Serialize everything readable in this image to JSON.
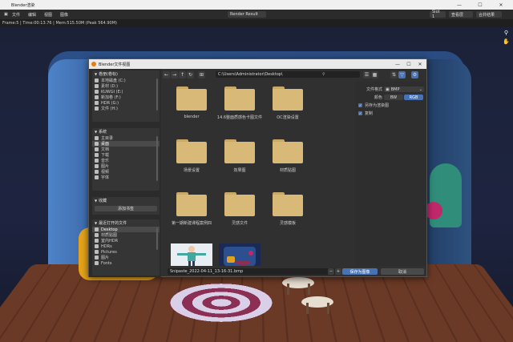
{
  "window": {
    "title": "Blender渲染",
    "controls": [
      "—",
      "☐",
      "✕"
    ]
  },
  "menubar": {
    "items": [
      "文件",
      "编辑",
      "视图",
      "图像"
    ],
    "image_name": "Render Result",
    "slot": "Slot 1",
    "layer": "查看层",
    "pass": "合并结果"
  },
  "infobar": {
    "text": "Frame:5 | Time:00:13.76 | Mem:515.50M (Peak 564.90M)"
  },
  "dialog": {
    "title": "Blender文件视图",
    "path": "C:\\Users\\Administrator\\Desktop\\",
    "search_placeholder": "",
    "sidebar": {
      "volumes": {
        "header": "卷册(卷标)",
        "items": [
          "本地磁盘 (C:)",
          "素材 (D:)",
          "KUWGI (E:)",
          "新加卷 (F:)",
          "HDR (G:)",
          "文件 (H:)"
        ]
      },
      "system": {
        "header": "系统",
        "items": [
          "主目录",
          "桌面",
          "文档",
          "下载",
          "音乐",
          "图片",
          "视频",
          "字体"
        ],
        "selected": 1
      },
      "bookmarks": {
        "header": "收藏",
        "add_label": "添加书签"
      },
      "recent": {
        "header": "最近打开的文件",
        "items": [
          "Desktop",
          "材质贴图",
          "室内HDR",
          "HDRs",
          "Pictures",
          "图片",
          "Fonts"
        ],
        "selected": 0
      }
    },
    "files": [
      {
        "name": "blender",
        "type": "folder"
      },
      {
        "name": "14.6整面质感色卡图文件",
        "type": "folder"
      },
      {
        "name": "OC渲染设置",
        "type": "folder"
      },
      {
        "name": "场景设置",
        "type": "folder"
      },
      {
        "name": "效果图",
        "type": "folder"
      },
      {
        "name": "材质贴图",
        "type": "folder"
      },
      {
        "name": "第一期新建课程案例四",
        "type": "folder"
      },
      {
        "name": "灵感文件",
        "type": "folder"
      },
      {
        "name": "灵感模板",
        "type": "folder"
      },
      {
        "name": "",
        "type": "image-character"
      },
      {
        "name": "",
        "type": "image-room"
      }
    ],
    "options": {
      "format_label": "文件格式",
      "format_value": "BMP",
      "color_label": "颜色",
      "color_options": [
        "BW",
        "RGB"
      ],
      "color_selected": "RGB",
      "save_as_render": "另存为渲染图",
      "copy": "复制"
    },
    "filename": "Snipaste_2022-04-11_13-16-31.bmp",
    "save_label": "保存为图像",
    "cancel_label": "取消",
    "colors": {
      "accent": "#4772b3",
      "folder": "#d8b978"
    }
  }
}
